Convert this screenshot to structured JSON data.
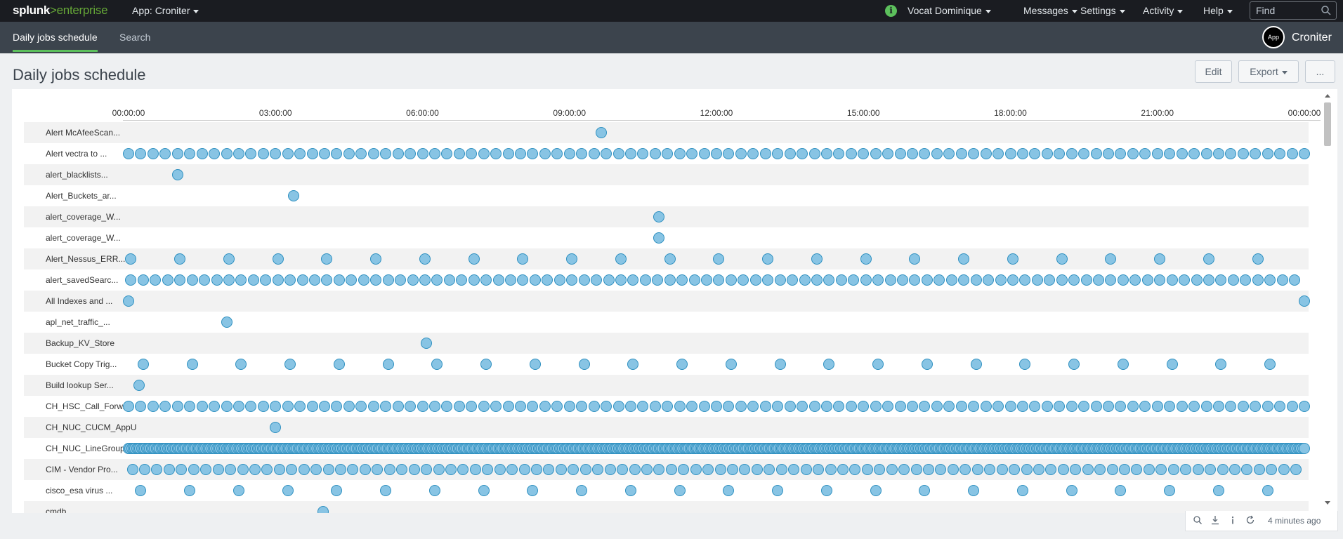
{
  "topbar": {
    "logo_brand": "splunk",
    "logo_sep": ">",
    "logo_product": "enterprise",
    "app_label": "App: Croniter",
    "user": "Vocat Dominique",
    "messages": "Messages",
    "settings": "Settings",
    "activity": "Activity",
    "help": "Help",
    "find_placeholder": "Find"
  },
  "nav": {
    "tab_dashboard": "Daily jobs schedule",
    "tab_search": "Search",
    "app_badge": "App",
    "app_name": "Croniter"
  },
  "page": {
    "title": "Daily jobs schedule",
    "edit": "Edit",
    "export": "Export",
    "more": "..."
  },
  "chart_data": {
    "type": "scatter",
    "x_ticks": [
      "00:00:00",
      "03:00:00",
      "06:00:00",
      "09:00:00",
      "12:00:00",
      "15:00:00",
      "18:00:00",
      "21:00:00",
      "00:00:00"
    ],
    "x_range_hours": [
      0,
      24
    ],
    "rows": [
      {
        "label": "Alert McAfeeScan...",
        "times": [
          9.65
        ]
      },
      {
        "label": "Alert vectra to ...",
        "every_minutes": 15,
        "start": 0
      },
      {
        "label": "alert_blacklists...",
        "times": [
          1.0
        ]
      },
      {
        "label": "Alert_Buckets_ar...",
        "times": [
          3.37
        ]
      },
      {
        "label": "alert_coverage_W...",
        "times": [
          10.83
        ]
      },
      {
        "label": "alert_coverage_W...",
        "times": [
          10.83
        ]
      },
      {
        "label": "Alert_Nessus_ERR...",
        "every_minutes": 60,
        "start": 0.05
      },
      {
        "label": "alert_savedSearc...",
        "every_minutes": 15,
        "start": 0.05
      },
      {
        "label": "All Indexes and ...",
        "times": [
          0.0,
          24.0
        ]
      },
      {
        "label": "apl_net_traffic_...",
        "times": [
          2.0
        ]
      },
      {
        "label": "Backup_KV_Store",
        "times": [
          6.08
        ]
      },
      {
        "label": "Bucket Copy Trig...",
        "every_minutes": 60,
        "start": 0.3
      },
      {
        "label": "Build lookup Ser...",
        "times": [
          0.22
        ]
      },
      {
        "label": "CH_HSC_Call_Forw...",
        "every_minutes": 15,
        "start": 0
      },
      {
        "label": "CH_NUC_CUCM_AppU...",
        "times": [
          3.0
        ]
      },
      {
        "label": "CH_NUC_LineGroup...",
        "every_minutes": 2,
        "start": 0
      },
      {
        "label": "CIM - Vendor Pro...",
        "every_minutes": 15,
        "start": 0.08
      },
      {
        "label": "cisco_esa virus ...",
        "every_minutes": 60,
        "start": 0.25
      },
      {
        "label": "cmdb",
        "times": [
          3.97
        ]
      }
    ]
  },
  "footer": {
    "refreshed": "4 minutes ago"
  },
  "colors": {
    "dot_fill": "#88c4e4",
    "dot_stroke": "#2f90c0",
    "topbar": "#1a1c21",
    "subnav": "#3c444d",
    "accent_green": "#5cc05c"
  }
}
